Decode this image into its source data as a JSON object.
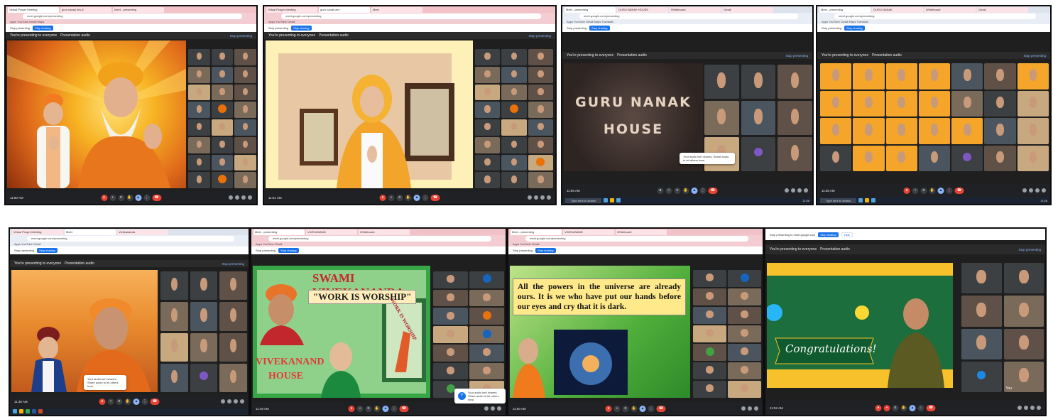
{
  "collage": {
    "shots": [
      {
        "id": "s1",
        "browser_tabs": [
          "Virtual Prayer Meeting",
          "guru nanak dev ji",
          "Meet - presenting"
        ],
        "omnibox": "meet.google.com/presenting",
        "bookmarks": "Apps  YouTube  Gmail  Maps",
        "share_prompt": "Stop presenting",
        "share_button": "Stop sharing",
        "presentation_label": "You're presenting to everyone",
        "presentation_audio": "Presentation audio",
        "stop_presenting": "Stop presenting",
        "clock": "11:50 AM",
        "meeting_code": "Meeting details",
        "tile_count": 24
      },
      {
        "id": "s2",
        "browser_tabs": [
          "Virtual Prayer Meeting",
          "guru nanak dev",
          "Meet"
        ],
        "omnibox": "meet.google.com/presenting",
        "bookmarks": "Apps  YouTube  Gmail",
        "share_prompt": "Stop presenting",
        "share_button": "Stop sharing",
        "presentation_label": "You're presenting to everyone",
        "presentation_audio": "Presentation audio",
        "stop_presenting": "Stop presenting",
        "clock": "11:51 AM",
        "meeting_code": "Meeting details",
        "tile_count": 24
      },
      {
        "id": "s3",
        "browser_tabs": [
          "Meet - presenting",
          "GURU NANAK HOUSE",
          "Whiteboard",
          "Gmail"
        ],
        "omnibox": "meet.google.com/presenting",
        "bookmarks": "Apps  YouTube  Gmail  Maps  Translate",
        "share_prompt": "Stop presenting",
        "share_button": "Stop sharing",
        "presentation_label": "You're presenting to everyone",
        "presentation_audio": "Presentation audio",
        "stop_presenting": "Stop presenting",
        "slide_title_line1": "GURU NANAK",
        "slide_title_line2": "HOUSE",
        "toast": "Your audio isn't shared. Share audio to let others hear.",
        "clock": "11:56 AM",
        "meeting_code": "Meeting details",
        "taskbar_search": "Type here to search",
        "taskbar_time": "11:56",
        "tile_count": 9
      },
      {
        "id": "s4",
        "browser_tabs": [
          "Meet - presenting",
          "GURU NANAK",
          "Whiteboard",
          "Gmail"
        ],
        "omnibox": "meet.google.com/presenting",
        "bookmarks": "Apps  YouTube  Gmail  Maps  Translate",
        "share_prompt": "Stop presenting",
        "share_button": "Stop sharing",
        "presentation_label": "You're presenting to everyone",
        "presentation_audio": "Presentation audio",
        "stop_presenting": "Stop presenting",
        "clock": "11:58 AM",
        "meeting_code": "Meeting details",
        "taskbar_search": "Type here to search",
        "taskbar_time": "11:58",
        "tile_count": 25
      },
      {
        "id": "s5",
        "browser_tabs": [
          "Virtual Prayer Meeting",
          "Meet",
          "Vivekananda"
        ],
        "omnibox": "meet.google.com/presenting",
        "bookmarks": "Apps  YouTube  Gmail",
        "share_prompt": "Stop presenting",
        "share_button": "Stop sharing",
        "presentation_label": "You're presenting to everyone",
        "presentation_audio": "Presentation audio",
        "stop_presenting": "Stop presenting",
        "toast": "Your audio isn't shared. Share audio to let others hear.",
        "clock": "11:48 AM",
        "meeting_code": "Meeting details",
        "tile_count": 12
      },
      {
        "id": "s6",
        "browser_tabs": [
          "Meet - presenting",
          "VIVEKANAND",
          "Whiteboard"
        ],
        "omnibox": "meet.google.com/presenting",
        "bookmarks": "Apps  YouTube  Gmail",
        "share_prompt": "Stop presenting",
        "share_button": "Stop sharing",
        "slide_title": "SWAMI VIVEKANANDA",
        "slide_subtitle": "\"WORK IS WORSHIP\"",
        "slide_side_text": "WORK IS WORSHIP",
        "house_line1": "VIVEKANAND",
        "house_line2": "HOUSE",
        "clock": "11:49 AM",
        "meeting_code": "Meeting details",
        "tile_count": 14
      },
      {
        "id": "s7",
        "browser_tabs": [
          "Meet - presenting",
          "VIVEKANAND",
          "Whiteboard"
        ],
        "omnibox": "meet.google.com/presenting",
        "bookmarks": "Apps  YouTube  Gmail",
        "share_prompt": "Stop presenting",
        "share_button": "Stop sharing",
        "quote": "All the powers in the universe are already ours. It is we who have put our hands before our eyes and cry that it is dark.",
        "clock": "11:50 AM",
        "meeting_code": "Meeting details",
        "toast_avatar": "Y",
        "toast": "Your audio isn't shared. Share audio to let others hear.",
        "tile_count": 14
      },
      {
        "id": "s8",
        "share_prompt": "Stop presenting to meet.google.com",
        "share_button": "Stop sharing",
        "share_hide": "Hide",
        "presentation_label": "You're presenting to everyone",
        "presentation_audio": "Presentation audio",
        "stop_presenting": "Stop presenting",
        "banner": "Congratulations!",
        "clock": "11:52 AM",
        "meeting_code": "Meeting details",
        "self_label": "You",
        "tile_count": 8
      }
    ]
  },
  "colors": {
    "browser_chrome": "#f4cdd3",
    "meet_dark": "#202124",
    "end_call": "#ea4335",
    "accent_blue": "#1a73e8",
    "saffron": "#f4a52a"
  }
}
